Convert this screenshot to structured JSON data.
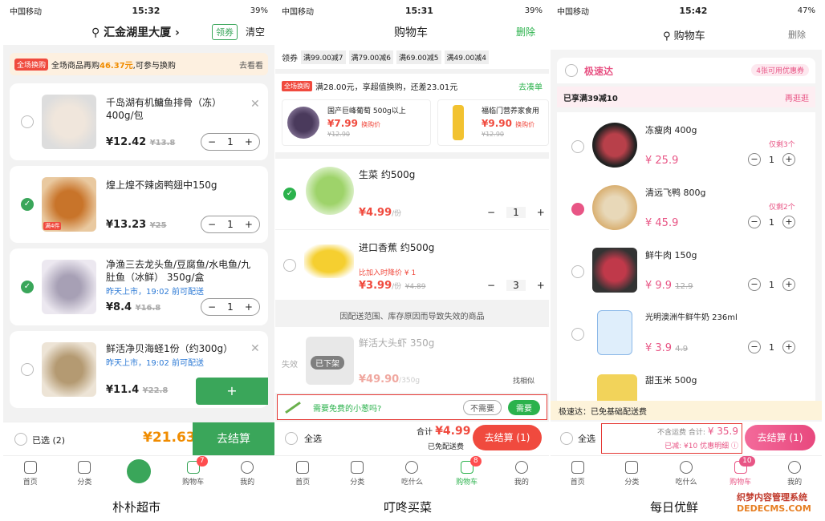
{
  "p1": {
    "status": {
      "carrier": "中国移动",
      "time": "15:32",
      "battery": "39%"
    },
    "header": {
      "location": "汇金湖里大厦",
      "coupon": "领券",
      "clear": "清空"
    },
    "promo": {
      "badge": "全场换购",
      "text_a": "全场商品再购",
      "amount": "46.37元",
      "text_b": ",可参与换购",
      "action": "去看看"
    },
    "items": [
      {
        "name": "千岛湖有机鳙鱼排骨（冻）400g/包",
        "price": "¥12.42",
        "orig": "¥13.8",
        "qty": "1"
      },
      {
        "name": "煌上煌不辣卤鸭翅中150g",
        "price": "¥13.23",
        "orig": "¥25",
        "qty": "1",
        "tag": "满4件"
      },
      {
        "name": "净渔三去龙头鱼/豆腐鱼/水电鱼/九肚鱼（冰鲜）   350g/盒",
        "note": "昨天上市，19:02 前可配送",
        "price": "¥8.4",
        "orig": "¥16.8",
        "qty": "1"
      },
      {
        "name": "鲜活净贝海蛏1份（约300g）",
        "note": "昨天上市，19:02 前可配送",
        "price": "¥11.4",
        "orig": "¥22.8"
      }
    ],
    "footer": {
      "selected": "已选 (2)",
      "total": "¥21.63",
      "checkout": "去结算"
    },
    "tabs": [
      "首页",
      "分类",
      "",
      "购物车",
      "我的"
    ],
    "cart_badge": "7",
    "caption": "朴朴超市"
  },
  "p2": {
    "status": {
      "carrier": "中国移动",
      "time": "15:31",
      "battery": "39%"
    },
    "header": {
      "title": "购物车",
      "delete": "删除"
    },
    "coupons": {
      "label": "领券",
      "items": [
        "满99.00减7",
        "满79.00减6",
        "满69.00减5",
        "满49.00减4"
      ]
    },
    "promo": {
      "badge": "全场换购",
      "text": "满28.00元，享超值换购，还差23.01元",
      "action": "去凑单"
    },
    "exchange": [
      {
        "name": "国产巨峰葡萄 500g以上",
        "price": "¥7.99",
        "label": "换购价",
        "orig": "¥12.90"
      },
      {
        "name": "福临门营养家食用",
        "price": "¥9.90",
        "label": "换购价",
        "orig": "¥12.90"
      }
    ],
    "items": [
      {
        "name": "生菜 约500g",
        "price": "¥4.99",
        "unit": "/份",
        "qty": "1"
      },
      {
        "name": "进口香蕉 约500g",
        "note": "比加入时降价 ¥ 1",
        "price": "¥3.99",
        "unit": "/份",
        "orig": "¥4.89",
        "qty": "3"
      }
    ],
    "invalid": {
      "notice": "因配送范围、库存原因而导致失效的商品",
      "tag": "失效",
      "overlay": "已下架",
      "name": "鲜活大头虾 350g",
      "price": "¥49.90",
      "unit": "/350g",
      "similar": "找相似"
    },
    "scallion": {
      "text": "需要免费的小葱吗?",
      "no": "不需要",
      "yes": "需要"
    },
    "footer": {
      "select_all": "全选",
      "total_label": "合计",
      "total": "¥4.99",
      "shipping": "已免配送费",
      "checkout": "去结算 (1)"
    },
    "tabs": [
      "首页",
      "分类",
      "吃什么",
      "购物车",
      "我的"
    ],
    "cart_badge": "8",
    "caption": "叮咚买菜"
  },
  "p3": {
    "status": {
      "carrier": "中国移动",
      "time": "15:42",
      "battery": "47%"
    },
    "header": {
      "title": "购物车",
      "delete": "删除"
    },
    "section": {
      "name": "极速达",
      "coupon": "4张可用优惠券"
    },
    "promo": {
      "text": "已享满39减10",
      "action": "再逛逛"
    },
    "items": [
      {
        "name": "冻瘦肉 400g",
        "price": "25.9",
        "stock": "仅剩3个",
        "qty": "1"
      },
      {
        "name": "清远飞鸭 800g",
        "price": "45.9",
        "stock": "仅剩2个",
        "qty": "1"
      },
      {
        "name": "鲜牛肉 150g",
        "price": "9.9",
        "orig": "12.9",
        "qty": "1"
      },
      {
        "name": "光明澳洲牛鲜牛奶 236ml",
        "price": "3.9",
        "orig": "4.9",
        "qty": "1"
      },
      {
        "name": "甜玉米 500g"
      }
    ],
    "notice": "极速达：已免基础配送费",
    "footer": {
      "select_all": "全选",
      "shipping": "不含运费",
      "total_label": "合计:",
      "total": "¥ 35.9",
      "saved": "已减: ¥10",
      "detail": "优惠明细",
      "checkout": "去结算 (1)"
    },
    "tabs": [
      "首页",
      "分类",
      "吃什么",
      "购物车",
      "我的"
    ],
    "cart_badge": "10",
    "caption": "每日优鲜"
  },
  "watermark": {
    "line1": "织梦内容管理系统",
    "line2": "DEDECMS.COM"
  },
  "colors": {
    "pupu_green": "#3aa65a",
    "dingdong_green": "#2bb24c",
    "dingdong_red": "#f04a3e",
    "missfresh_pink": "#e85585"
  }
}
